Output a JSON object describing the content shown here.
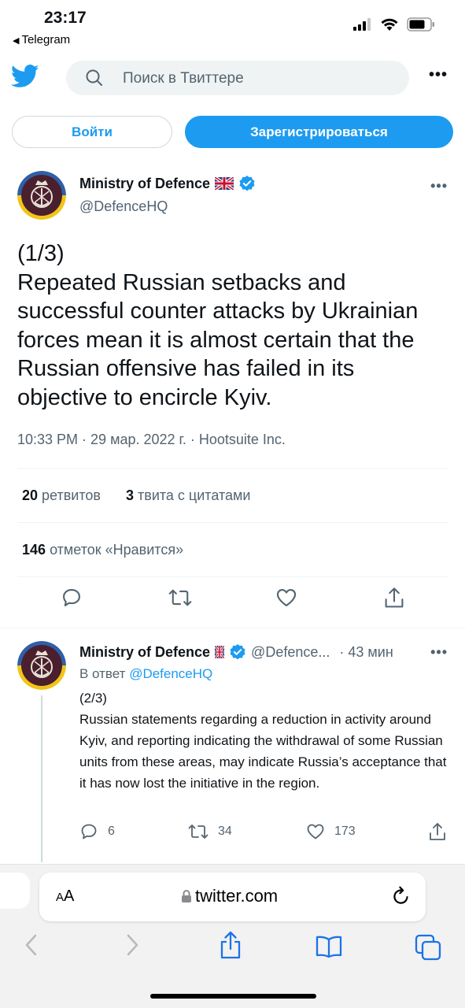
{
  "status_bar": {
    "time": "23:17",
    "back_app": "Telegram",
    "icons": [
      "cellular-signal-icon",
      "wifi-icon",
      "battery-icon"
    ]
  },
  "header": {
    "logo": "twitter-bird-icon",
    "search_placeholder": "Поиск в Твиттере"
  },
  "auth": {
    "login_label": "Войти",
    "signup_label": "Зарегистрироваться"
  },
  "main_tweet": {
    "author_name": "Ministry of Defence",
    "author_handle": "@DefenceHQ",
    "text": "(1/3)\nRepeated Russian setbacks and successful counter attacks by Ukrainian forces mean it is almost certain that the Russian offensive has failed in its objective to encircle Kyiv.",
    "meta": "10:33 PM · 29 мар. 2022 г. · Hootsuite Inc.",
    "retweets_count": "20",
    "retweets_label": "ретвитов",
    "quotes_count": "3",
    "quotes_label": "твита с цитатами",
    "likes_count": "146",
    "likes_label": "отметок «Нравится»"
  },
  "reply_tweet": {
    "author_name": "Ministry of Defence",
    "author_handle": "@Defence...",
    "time": "· 43 мин",
    "in_reply_prefix": "В ответ",
    "in_reply_handle": "@DefenceHQ",
    "text": "(2/3)\nRussian statements regarding a reduction in activity around Kyiv, and reporting indicating the withdrawal of some Russian units from these areas, may indicate Russia’s acceptance that it has now lost the initiative in the region.",
    "replies": "6",
    "retweets": "34",
    "likes": "173"
  },
  "safari": {
    "aa_small": "A",
    "aa_big": "A",
    "url": "twitter.com"
  },
  "colors": {
    "accent": "#1d9bf0",
    "muted": "#536471",
    "text": "#0f1419"
  }
}
